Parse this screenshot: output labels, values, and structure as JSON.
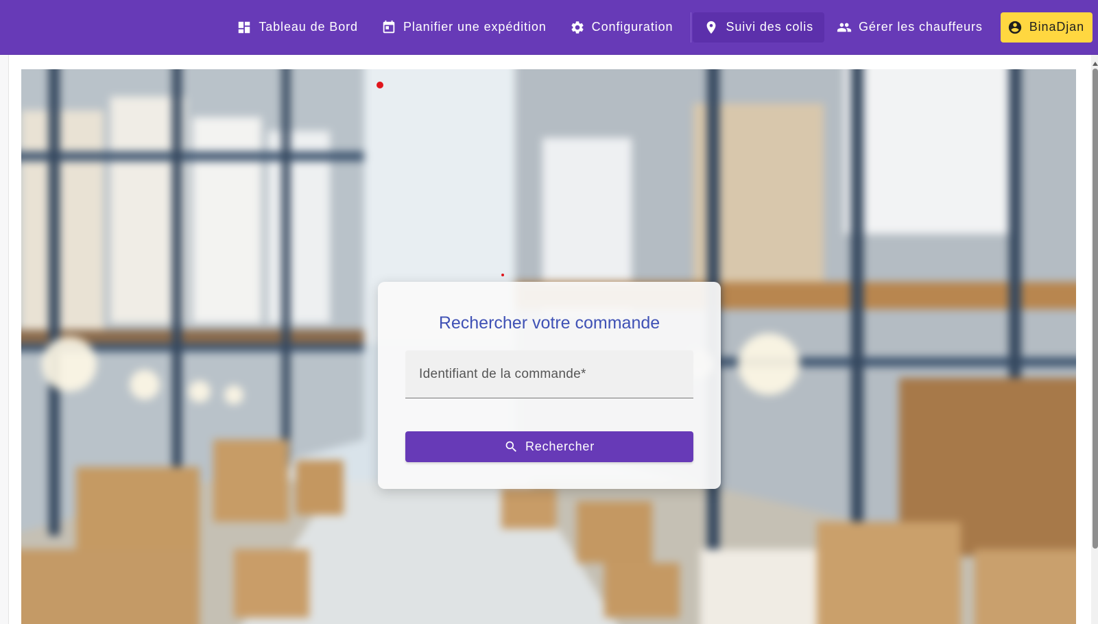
{
  "nav": {
    "items": [
      {
        "label": "Tableau de Bord",
        "icon": "dashboard-icon"
      },
      {
        "label": "Planifier une expédition",
        "icon": "calendar-icon"
      },
      {
        "label": "Configuration",
        "icon": "gear-icon"
      },
      {
        "label": "Suivi des colis",
        "icon": "location-pin-icon",
        "active": true
      },
      {
        "label": "Gérer les chauffeurs",
        "icon": "people-icon"
      }
    ],
    "user": {
      "label": "BinaDjan",
      "icon": "account-circle-icon"
    }
  },
  "search_card": {
    "title": "Rechercher votre commande",
    "input_label": "Identifiant de la commande*",
    "input_value": "",
    "button_label": "Rechercher",
    "button_icon": "search-icon"
  },
  "hero": {
    "image": "warehouse-background"
  },
  "colors": {
    "primary": "#673ab7",
    "accent": "#ffd740",
    "title": "#3f51b5"
  }
}
